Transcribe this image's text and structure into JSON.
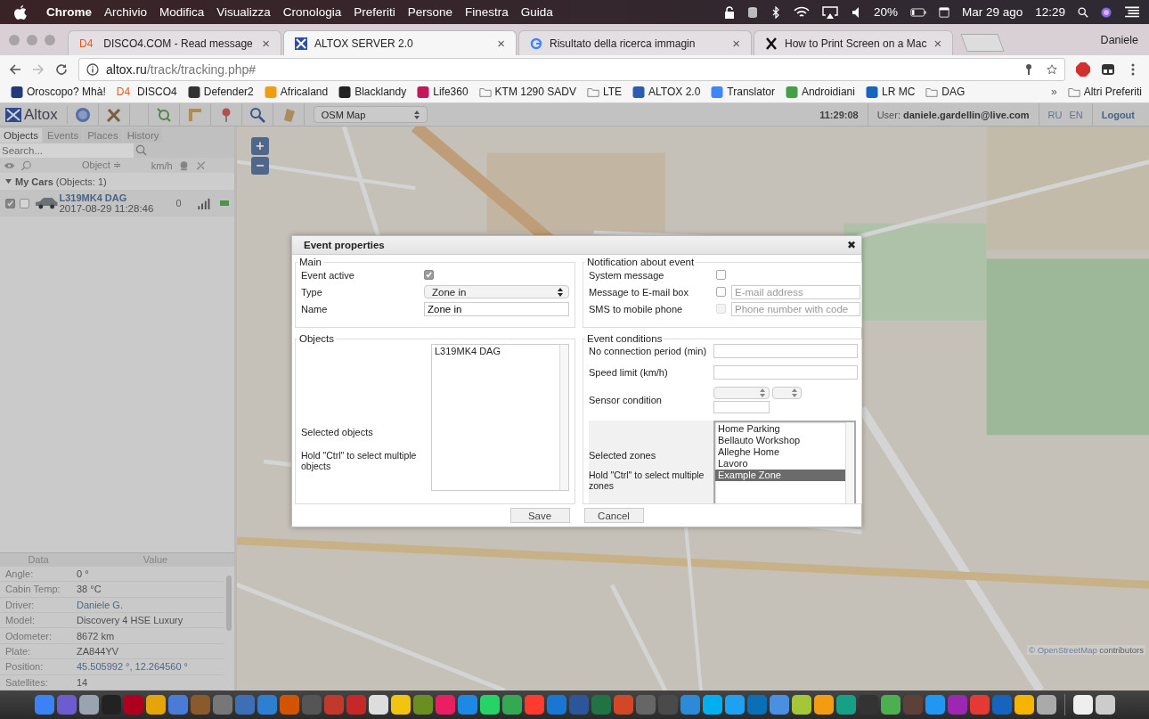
{
  "menu_bar": {
    "app": "Chrome",
    "items": [
      "Archivio",
      "Modifica",
      "Visualizza",
      "Cronologia",
      "Preferiti",
      "Persone",
      "Finestra",
      "Guida"
    ],
    "battery": "20%",
    "date": "Mar 29 ago",
    "time": "12:29"
  },
  "browser": {
    "tabs": [
      {
        "badge": "D4",
        "title": "DISCO4.COM - Read message",
        "close": "×",
        "selected": false
      },
      {
        "title": "ALTOX SERVER 2.0",
        "close": "×",
        "selected": true
      },
      {
        "title": "Risultato della ricerca immagin",
        "close": "×",
        "selected": false
      },
      {
        "title": "How to Print Screen on a Mac",
        "close": "×",
        "selected": false
      }
    ],
    "profile": "Daniele",
    "url_host": "altox.ru",
    "url_path": "/track/tracking.php#",
    "bookmarks": [
      {
        "label": "Oroscopo? Mhà!",
        "kind": "image"
      },
      {
        "badge": "D4",
        "label": "DISCO4",
        "kind": "text"
      },
      {
        "label": "Defender2",
        "kind": "image"
      },
      {
        "label": "Africaland",
        "kind": "image"
      },
      {
        "label": "Blacklandy",
        "kind": "image"
      },
      {
        "label": "Life360",
        "kind": "image"
      },
      {
        "label": "KTM 1290 SADV",
        "kind": "folder"
      },
      {
        "label": "LTE",
        "kind": "folder"
      },
      {
        "label": "ALTOX 2.0",
        "kind": "image"
      },
      {
        "label": "Translator",
        "kind": "image"
      },
      {
        "label": "Androidiani",
        "kind": "image"
      },
      {
        "label": "LR MC",
        "kind": "image"
      },
      {
        "label": "DAG",
        "kind": "folder"
      }
    ],
    "more": "»",
    "other_bookmarks": "Altri Preferiti"
  },
  "app_toolbar": {
    "logo": "Altox",
    "map_select": "OSM Map",
    "clock": "11:29:08",
    "user_label": "User:",
    "user": "daniele.gardellin@live.com",
    "languages": [
      "RU",
      "EN"
    ],
    "logout": "Logout"
  },
  "side_tabs": [
    {
      "label": "Objects",
      "selected": true
    },
    {
      "label": "Events",
      "selected": false
    },
    {
      "label": "Places",
      "selected": false
    },
    {
      "label": "History",
      "selected": false
    }
  ],
  "search": {
    "placeholder": "Search..."
  },
  "object_columns": {
    "object": "Object ≑",
    "speed": "km/h"
  },
  "groups": [
    {
      "name": "My Cars",
      "count": "(Objects: 1)",
      "expanded": true,
      "objects": [
        {
          "name": "L319MK4 DAG",
          "time": "2017-08-29 11:28:46",
          "speed": "0",
          "visible": true,
          "checked": false,
          "online": true
        }
      ]
    }
  ],
  "data_table": {
    "columns": [
      "Data",
      "Value"
    ],
    "rows": [
      {
        "label": "Angle:",
        "value": "0 °",
        "link": false
      },
      {
        "label": "Cabin Temp:",
        "value": "38 °C",
        "link": false
      },
      {
        "label": "Driver:",
        "value": "Daniele G.",
        "link": true
      },
      {
        "label": "Model:",
        "value": "Discovery 4 HSE Luxury",
        "link": false
      },
      {
        "label": "Odometer:",
        "value": "8672 km",
        "link": false
      },
      {
        "label": "Plate:",
        "value": "ZA844YV",
        "link": false
      },
      {
        "label": "Position:",
        "value": "45.505992 °, 12.264560 °",
        "link": true
      },
      {
        "label": "Satellites:",
        "value": "14",
        "link": false
      }
    ]
  },
  "map": {
    "zoom_in": "+",
    "zoom_out": "−",
    "attribution_link": "© OpenStreetMap",
    "attribution_text": "contributors"
  },
  "dialog": {
    "title": "Event properties",
    "close": "✖",
    "main": {
      "legend": "Main",
      "active_label": "Event active",
      "active": true,
      "type_label": "Type",
      "type": "Zone in",
      "name_label": "Name",
      "name": "Zone in"
    },
    "notification": {
      "legend": "Notification about event",
      "rows": [
        {
          "label": "System message",
          "checked": false,
          "disabled": false
        },
        {
          "label": "Message to E-mail box",
          "checked": false,
          "disabled": false,
          "placeholder": "E-mail address"
        },
        {
          "label": "SMS to mobile phone",
          "checked": false,
          "disabled": true,
          "placeholder": "Phone number with code"
        }
      ]
    },
    "objects": {
      "legend": "Objects",
      "label": "Selected objects",
      "hint": "Hold \"Ctrl\" to select multiple objects",
      "items": [
        {
          "label": "L319MK4 DAG",
          "selected": false
        }
      ]
    },
    "conditions": {
      "legend": "Event conditions",
      "no_connection_label": "No connection period (min)",
      "speed_label": "Speed limit (km/h)",
      "sensor_label": "Sensor condition",
      "zones_label": "Selected zones",
      "zones_hint": "Hold \"Ctrl\" to select multiple zones",
      "zones": [
        {
          "label": "Home Parking",
          "selected": false
        },
        {
          "label": "Bellauto Workshop",
          "selected": false
        },
        {
          "label": "Alleghe Home",
          "selected": false
        },
        {
          "label": "Lavoro",
          "selected": false
        },
        {
          "label": "Example Zone",
          "selected": true
        }
      ]
    },
    "buttons": [
      "Save",
      "Cancel"
    ]
  }
}
